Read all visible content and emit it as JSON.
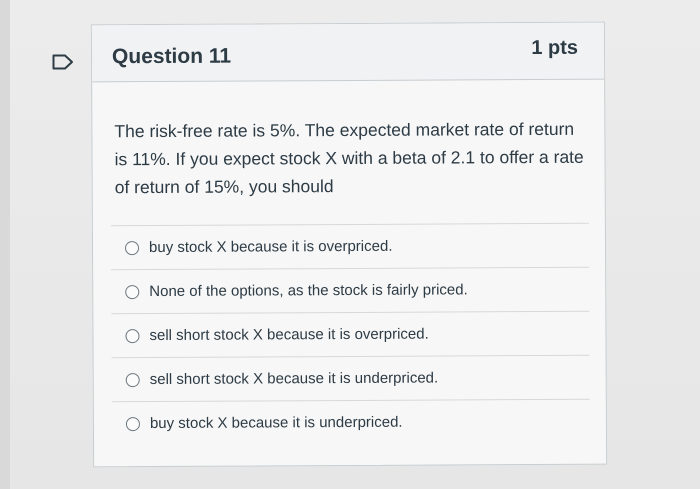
{
  "question": {
    "title": "Question 11",
    "points": "1 pts",
    "text": "The risk-free rate is 5%. The expected market rate of return is 11%. If you expect stock X with a beta of 2.1 to offer a rate of return of 15%, you should"
  },
  "answers": [
    {
      "label": "buy stock X because it is overpriced."
    },
    {
      "label": "None of the options, as the stock is fairly priced."
    },
    {
      "label": "sell short stock X because it is overpriced."
    },
    {
      "label": "sell short stock X because it is underpriced."
    },
    {
      "label": "buy stock X because it is underpriced."
    }
  ],
  "colors": {
    "text": "#2d3b45",
    "header_bg": "#f1f2f3",
    "border": "#c7cdd1",
    "flag": "#2d3b45"
  },
  "icons": {
    "flag": "flag-question-icon"
  }
}
